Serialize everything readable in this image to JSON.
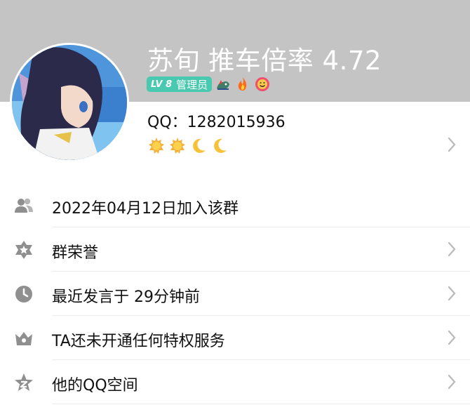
{
  "profile": {
    "nickname": "苏旬 推车倍率 4.72",
    "level_badge": {
      "level": "LV 8",
      "role": "管理员"
    },
    "badge_icons": [
      "dragon-icon",
      "fire-icon",
      "smiley-icon"
    ],
    "qq_id": "QQ：1282015936",
    "qq_level_icons": [
      "sun-icon",
      "sun-icon",
      "moon-icon",
      "moon-icon"
    ]
  },
  "menu": [
    {
      "label": "2022年04月12日加入该群",
      "icon": "people-icon",
      "has_chevron": false
    },
    {
      "label": "群荣誉",
      "icon": "star-badge-icon",
      "has_chevron": true
    },
    {
      "label": "最近发言于 29分钟前",
      "icon": "clock-icon",
      "has_chevron": true
    },
    {
      "label": "TA还未开通任何特权服务",
      "icon": "crown-icon",
      "has_chevron": true
    },
    {
      "label": "他的QQ空间",
      "icon": "qzone-star-icon",
      "has_chevron": true
    }
  ],
  "colors": {
    "header": "#c4c4c4",
    "level_badge": "#48c9b0",
    "icon_gray": "#8f8f8f",
    "chevron": "#b9b9b9"
  }
}
